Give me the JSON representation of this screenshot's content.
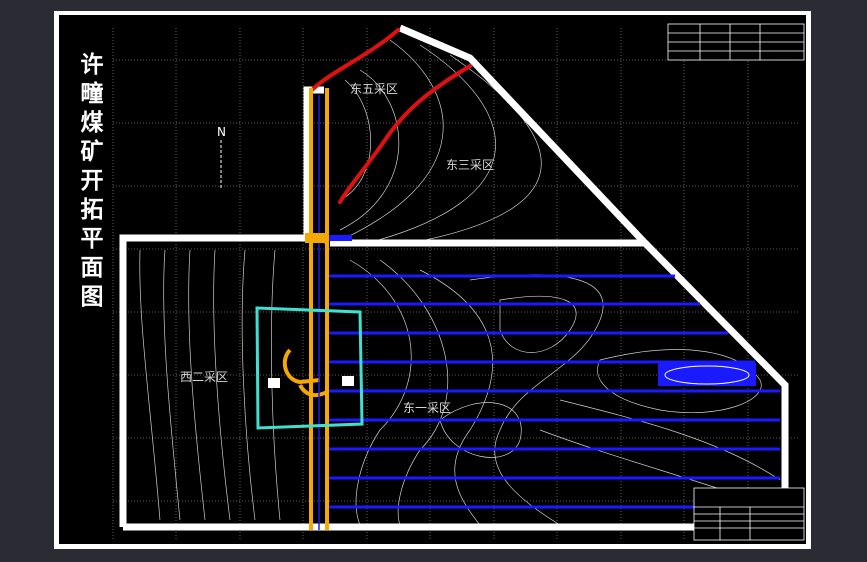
{
  "title_chars": [
    "许",
    "疃",
    "煤",
    "矿",
    "开",
    "拓",
    "平",
    "面",
    "图"
  ],
  "north_label": "N",
  "zone_labels": {
    "east_five": "东五采区",
    "east_three": "东三采区",
    "west_two": "西二采区",
    "east_one": "东一采区"
  },
  "colors": {
    "background": "#000000",
    "frame": "#ffffff",
    "boundary": "#ffffff",
    "roadway_yellow": "#f5a800",
    "panel_blue": "#1a1aff",
    "fault_red": "#e01010",
    "shaft_cyan": "#40e0d0",
    "grid": "#7a7a7a",
    "contour": "#d0d0d0"
  }
}
